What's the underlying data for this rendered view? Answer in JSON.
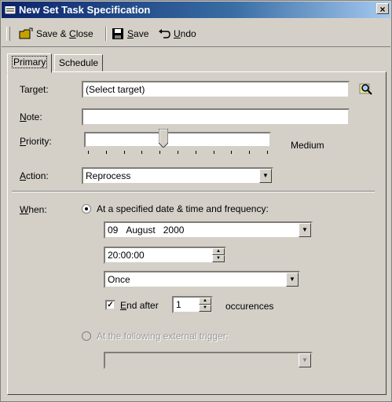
{
  "window": {
    "title": "New Set Task Specification",
    "close_glyph": "×"
  },
  "toolbar": {
    "save_close_label": "Save & Close",
    "save_label": "Save",
    "undo_label": "Undo"
  },
  "tabs": [
    {
      "label": "Primary"
    },
    {
      "label": "Schedule"
    }
  ],
  "form": {
    "target_label": "Target:",
    "target_value": "(Select target)",
    "note_label": "Note:",
    "note_value": "",
    "priority_label": "Priority:",
    "priority_text": "Medium",
    "priority_level": 0.42,
    "priority_ticks": 11,
    "action_label": "Action:",
    "action_value": "Reprocess",
    "when_label": "When:",
    "when_option1": "At a specified date & time and frequency:",
    "date_day": "09",
    "date_month": "August",
    "date_year": "2000",
    "time_value": "20:00:00",
    "frequency_value": "Once",
    "end_after_label": "End after",
    "end_after_value": "1",
    "occurences_label": "occurences",
    "when_option2": "At the following external trigger:",
    "trigger_value": ""
  },
  "colors": {
    "title_start": "#0a246a",
    "title_end": "#a6caf0",
    "face": "#d4d0c8"
  }
}
